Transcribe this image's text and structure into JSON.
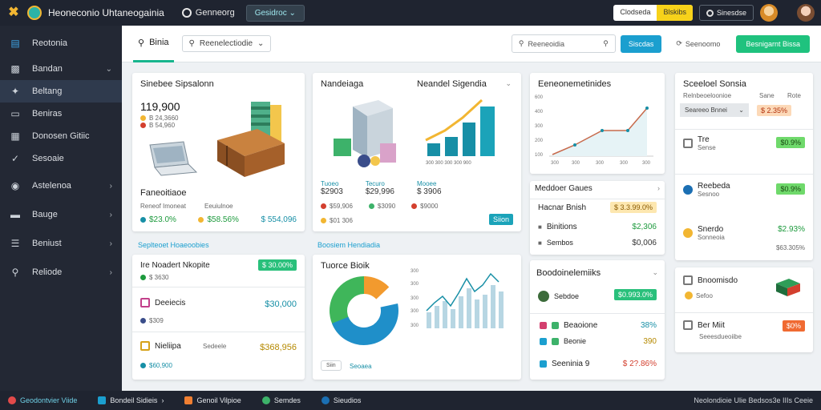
{
  "app": {
    "title": "Heoneconio Uhtaneogainia"
  },
  "topbar": {
    "link": "Genneorg",
    "dropdown": "Gesidroc",
    "search_label": "Clodseda",
    "search_tag": "Blskibs",
    "button": "Sinesdse"
  },
  "sidebar": {
    "items": [
      {
        "label": "Reotonia"
      },
      {
        "label": "Bandan"
      },
      {
        "label": "Beltang"
      },
      {
        "label": "Beniras"
      },
      {
        "label": "Donosen Gitiic"
      },
      {
        "label": "Sesoaie"
      },
      {
        "label": "Astelenoa"
      },
      {
        "label": "Bauge"
      },
      {
        "label": "Beniust"
      },
      {
        "label": "Reliode"
      }
    ]
  },
  "header": {
    "tab": "Binia",
    "dropdown": "Reenelectiodie",
    "search_placeholder": "Reeneoidia",
    "blue_button": "Siscdas",
    "link": "Seenoomo",
    "green_button": "Besnigarnt Bissa"
  },
  "card1": {
    "title": "Sinebee Sipsalonn",
    "big_value": "119,900",
    "sub1": "B 24,3660",
    "sub2": "B 54,960",
    "footer_title": "Faneoitiaoe",
    "footer_sub1": "Reneof Imoneat",
    "footer_sub2": "Eeuiulnoe",
    "v1": "$23.0%",
    "v2": "$58.56%",
    "v3": "$ 554,096"
  },
  "card2": {
    "title": "Nandeiaga",
    "title2": "Neandel Sigendia",
    "c1_label": "Tuoeo",
    "c1_value": "$2903",
    "c2_label": "Tecuro",
    "c2_value": "$29,996",
    "c3_label": "Mooee",
    "c3_value": "$ 3906",
    "r1": "$59,906",
    "r2": "$3090",
    "r3": "$9000",
    "r4": "$01 306",
    "badge": "Siion"
  },
  "card3": {
    "title": "Eeneonemetinides",
    "y_ticks": [
      "600",
      "400",
      "300",
      "200",
      "100",
      "0"
    ],
    "x_ticks": [
      "300",
      "300",
      "300",
      "300",
      "300",
      "300"
    ]
  },
  "card4": {
    "title": "Sceeloel Sonsia",
    "col1": "Sane",
    "col2": "Rote",
    "subhead": "Relnbeoeloonioe",
    "drop": "Seareeo Bnnei",
    "drop_value": "$ 2.35%",
    "rows": [
      {
        "label": "Tre",
        "sub": "Sense",
        "value": "$0.9%"
      },
      {
        "label": "Reebeda",
        "sub": "Sesnoo",
        "value": "$0.9%"
      },
      {
        "label": "Snerdo",
        "sub": "Sonneoia",
        "value": "$2.93%",
        "sub2": "$63.305%"
      }
    ]
  },
  "sec_left": "Seplteoet Hoaeoobies",
  "sec_mid": "Boosiem Hendiadia",
  "card5": {
    "title": "Ire Noadert Nkopite",
    "badge": "$ 30.00%",
    "r1_sub": "$ 3630",
    "r2_label": "Deeiecis",
    "r2_value": "$30,000",
    "r2_sub": "$309",
    "r3_label": "Nieliipa",
    "r3_mid": "Sedeele",
    "r3_value": "$368,956",
    "r3_sub": "$60,900"
  },
  "card6": {
    "title": "Tuorce Bioik",
    "y_ticks": [
      "300",
      "300",
      "300",
      "300",
      "300",
      "0"
    ],
    "btn": "Siin",
    "btn_label": "Seoaea"
  },
  "card7": {
    "title": "Meddoer Gaues",
    "rows": [
      {
        "label": "Hacnar Bnish",
        "value": "$ 3.3.99.0%"
      },
      {
        "label": "Binitions",
        "value": "$2,306"
      },
      {
        "label": "Sembos",
        "value": "$0,006"
      }
    ]
  },
  "card8": {
    "title": "Boodoinelemiiks",
    "sub_label": "Sebdoe",
    "badge": "$0.993.0%",
    "rows": [
      {
        "label": "Beaoione",
        "value": "38%"
      },
      {
        "label": "Beonie",
        "value": "390"
      },
      {
        "label": "Seeninia 9",
        "value": "$ 2?.86%"
      }
    ]
  },
  "card9": {
    "title": "Bnoomisdo",
    "sub": "Sefoo",
    "r2_label": "Ber Miit",
    "r2_sub": "Seeesdueoiibe",
    "badge": "$0%"
  },
  "footer": {
    "items": [
      "Geodontvier Viide",
      "Bondeil Sidieis",
      "Genoil Vilpioe",
      "Semdes",
      "Sieudios"
    ],
    "right": "Neolondioie Ulie   Bedsos3e IIIs   Ceeie"
  },
  "colors": {
    "accent": "#1b9fcf",
    "green": "#1fc27e",
    "dark": "#1f2430"
  }
}
